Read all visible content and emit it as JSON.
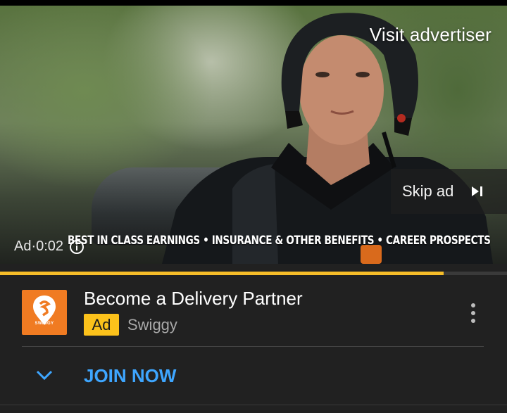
{
  "video": {
    "visit_advertiser": "Visit advertiser",
    "skip_ad": "Skip ad",
    "ad_timer": "Ad·0:02",
    "caption": "BEST IN CLASS EARNINGS • INSURANCE & OTHER BENEFITS • CAREER PROSPECTS",
    "progress_fraction": 0.875
  },
  "ad_card": {
    "logo_text": "SWIGGY",
    "title": "Become a Delivery Partner",
    "ad_badge": "Ad",
    "advertiser": "Swiggy",
    "cta": "JOIN NOW"
  },
  "icons": [
    "skip-next-icon",
    "info-icon",
    "swiggy-logo",
    "more-vert-icon",
    "chevron-down-icon"
  ],
  "colors": {
    "accent_yellow": "#fcc21b",
    "progress": "#f6bd29",
    "link_blue": "#3ea6ff",
    "brand_orange": "#f07b22",
    "background": "#212121"
  }
}
